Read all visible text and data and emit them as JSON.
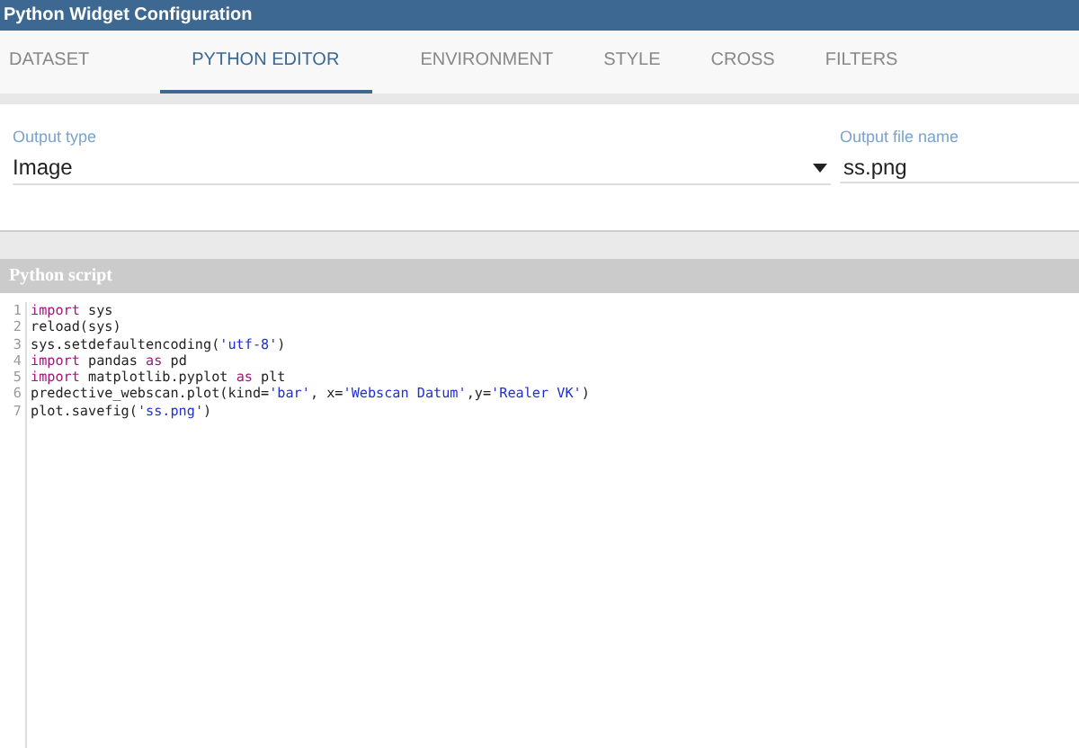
{
  "window": {
    "title": "Python Widget Configuration"
  },
  "tabs": [
    {
      "label": "DATASET",
      "selected": false
    },
    {
      "label": "PYTHON EDITOR",
      "selected": true
    },
    {
      "label": "ENVIRONMENT",
      "selected": false
    },
    {
      "label": "STYLE",
      "selected": false
    },
    {
      "label": "CROSS",
      "selected": false
    },
    {
      "label": "FILTERS",
      "selected": false
    }
  ],
  "output_type": {
    "label": "Output type",
    "value": "Image"
  },
  "output_file": {
    "label": "Output file name",
    "value": "ss.png"
  },
  "script": {
    "title": "Python script",
    "lines": [
      {
        "number": "1",
        "tokens": [
          {
            "kind": "keyword",
            "text": "import"
          },
          {
            "kind": "plain",
            "text": " sys"
          }
        ]
      },
      {
        "number": "2",
        "tokens": [
          {
            "kind": "plain",
            "text": "reload(sys)"
          }
        ]
      },
      {
        "number": "3",
        "tokens": [
          {
            "kind": "plain",
            "text": "sys.setdefaultencoding("
          },
          {
            "kind": "string",
            "text": "'utf-8'"
          },
          {
            "kind": "plain",
            "text": ")"
          }
        ]
      },
      {
        "number": "4",
        "tokens": [
          {
            "kind": "keyword",
            "text": "import"
          },
          {
            "kind": "plain",
            "text": " pandas "
          },
          {
            "kind": "keyword",
            "text": "as"
          },
          {
            "kind": "plain",
            "text": " pd"
          }
        ]
      },
      {
        "number": "5",
        "tokens": [
          {
            "kind": "keyword",
            "text": "import"
          },
          {
            "kind": "plain",
            "text": " matplotlib.pyplot "
          },
          {
            "kind": "keyword",
            "text": "as"
          },
          {
            "kind": "plain",
            "text": " plt"
          }
        ]
      },
      {
        "number": "6",
        "tokens": [
          {
            "kind": "plain",
            "text": "predective_webscan.plot(kind="
          },
          {
            "kind": "string",
            "text": "'bar'"
          },
          {
            "kind": "plain",
            "text": ", x="
          },
          {
            "kind": "string",
            "text": "'Webscan Datum'"
          },
          {
            "kind": "plain",
            "text": ",y="
          },
          {
            "kind": "string",
            "text": "'Realer VK'"
          },
          {
            "kind": "plain",
            "text": ")"
          }
        ]
      },
      {
        "number": "7",
        "tokens": [
          {
            "kind": "plain",
            "text": "plot.savefig("
          },
          {
            "kind": "string",
            "text": "'ss.png'"
          },
          {
            "kind": "plain",
            "text": ")"
          }
        ]
      }
    ]
  }
}
